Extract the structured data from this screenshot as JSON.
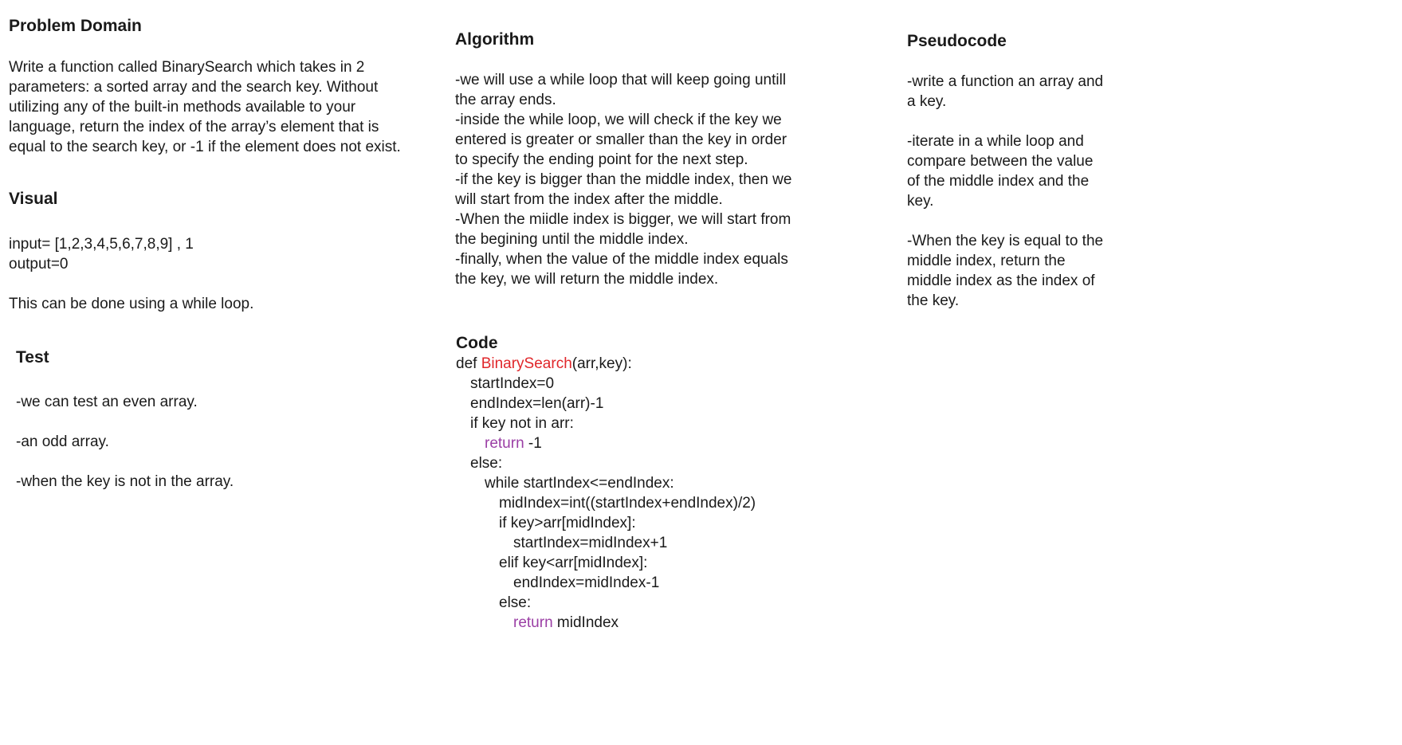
{
  "problem_domain": {
    "heading": "Problem Domain",
    "lines": [
      "Write a function called BinarySearch which takes in 2",
      "parameters: a sorted array and the search key. Without",
      "utilizing any of the built-in methods available to your",
      "language, return the index of the array’s element that is",
      "equal to the search key, or -1 if the element does not exist."
    ]
  },
  "visual": {
    "heading": "Visual",
    "input_line": "input= [1,2,3,4,5,6,7,8,9] , 1",
    "output_line": "output=0",
    "note": "This can be done using a while loop."
  },
  "test": {
    "heading": "Test",
    "items": [
      "-we can test an even array.",
      "-an odd array.",
      "-when the key is not in the array."
    ]
  },
  "algorithm": {
    "heading": "Algorithm",
    "lines": [
      "-we will use a while loop that will keep going untill",
      "the array ends.",
      "-inside the while loop, we will check if the key we",
      "entered is greater or smaller than the key in order",
      "to specify the ending point for the next step.",
      "-if the key is bigger than the middle index, then we",
      "will start from the index after the middle.",
      "-When the miidle index is bigger, we will start from",
      "the begining until the middle index.",
      "-finally, when the value of the middle index equals",
      "the key, we will return the middle index."
    ]
  },
  "code": {
    "heading": "Code",
    "def_kw": "def ",
    "fn_name": "BinarySearch",
    "def_rest": "(arr,key):",
    "l1": "startIndex=0",
    "l2": "endIndex=len(arr)-1",
    "l3": "if key not in arr:",
    "l4_kw": "return",
    "l4_rest": " -1",
    "l5": "else:",
    "l6": "while startIndex<=endIndex:",
    "l7": "midIndex=int((startIndex+endIndex)/2)",
    "l8": "if key>arr[midIndex]:",
    "l9": "startIndex=midIndex+1",
    "l10": "elif key<arr[midIndex]:",
    "l11": "endIndex=midIndex-1",
    "l12": "else:",
    "l13_kw": "return",
    "l13_rest": " midIndex",
    "colors": {
      "function_name": "#e0262a",
      "keyword": "#9b3fa5"
    }
  },
  "pseudocode": {
    "heading": "Pseudocode",
    "p1": [
      "-write a function an array and",
      "a key."
    ],
    "p2": [
      "-iterate in a while loop and",
      "compare between the value",
      "of the middle index and the",
      "key."
    ],
    "p3": [
      "-When the key is equal to the",
      "middle index, return the",
      "middle index as the index of",
      "the key."
    ]
  }
}
